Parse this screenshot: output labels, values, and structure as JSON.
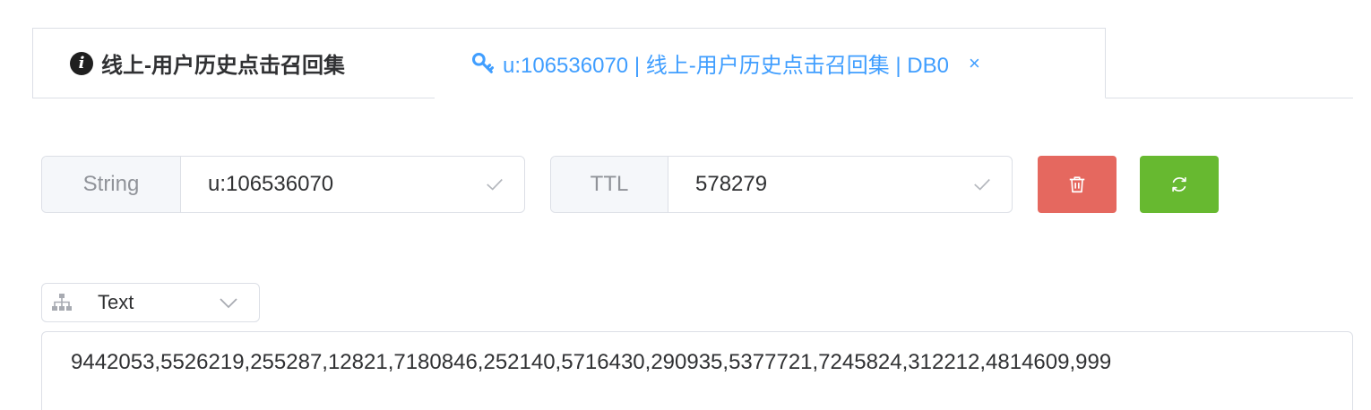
{
  "tabs": [
    {
      "label": "线上-用户历史点击召回集",
      "icon": "info-icon"
    },
    {
      "label": "u:106536070 | 线上-用户历史点击召回集 | DB0",
      "icon": "key-icon",
      "close": "×"
    }
  ],
  "key_group": {
    "type_label": "String",
    "key_value": "u:106536070"
  },
  "ttl_group": {
    "label": "TTL",
    "value": "578279"
  },
  "actions": {
    "delete_icon": "trash-icon",
    "refresh_icon": "refresh-icon"
  },
  "format": {
    "selected": "Text"
  },
  "value": "9442053,5526219,255287,12821,7180846,252140,5716430,290935,5377721,7245824,312212,4814609,999",
  "colors": {
    "accent": "#409eff",
    "danger": "#e5685f",
    "success": "#67b930",
    "border": "#dcdfe6"
  }
}
